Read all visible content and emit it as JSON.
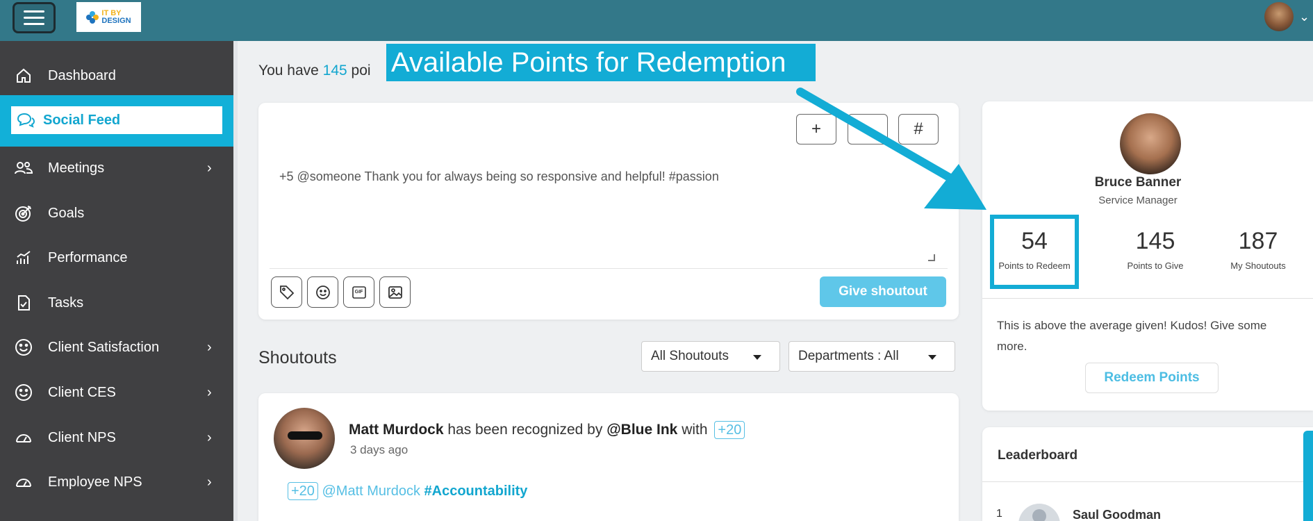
{
  "header": {
    "logo_text_top": "IT BY",
    "logo_text_bottom": "DESIGN",
    "user_menu_chevron": "⌄"
  },
  "sidebar": {
    "items": [
      {
        "label": "Dashboard",
        "icon": "home-icon",
        "has_submenu": false,
        "active": false
      },
      {
        "label": "Social Feed",
        "icon": "chat-icon",
        "has_submenu": false,
        "active": true
      },
      {
        "label": "Meetings",
        "icon": "people-icon",
        "has_submenu": true,
        "active": false
      },
      {
        "label": "Goals",
        "icon": "target-icon",
        "has_submenu": false,
        "active": false
      },
      {
        "label": "Performance",
        "icon": "performance-chart-icon",
        "has_submenu": false,
        "active": false
      },
      {
        "label": "Tasks",
        "icon": "task-document-icon",
        "has_submenu": false,
        "active": false
      },
      {
        "label": "Client Satisfaction",
        "icon": "smiley-icon",
        "has_submenu": true,
        "active": false
      },
      {
        "label": "Client CES",
        "icon": "smiley-icon",
        "has_submenu": true,
        "active": false
      },
      {
        "label": "Client NPS",
        "icon": "gauge-icon",
        "has_submenu": true,
        "active": false
      },
      {
        "label": "Employee NPS",
        "icon": "gauge-icon",
        "has_submenu": true,
        "active": false
      }
    ],
    "chevron": "›"
  },
  "points_banner": {
    "prefix": "You have",
    "points": "145",
    "suffix_visible": "poi"
  },
  "callout": {
    "text": "Available Points for Redemption",
    "color": "#13acd5"
  },
  "composer": {
    "toolbar": [
      "+",
      "•",
      "#"
    ],
    "text": "+5 @someone Thank you for always being so responsive and helpful! #passion",
    "attachments": [
      "tag-icon",
      "emoji-icon",
      "gif-icon",
      "image-icon"
    ],
    "gif_label": "GIF",
    "submit_label": "Give shoutout"
  },
  "shoutouts": {
    "title": "Shoutouts",
    "filter_all": "All Shoutouts",
    "filter_departments": "Departments : All"
  },
  "feed": {
    "items": [
      {
        "recipient": "Matt Murdock",
        "middle": "has been recognized by",
        "giver": "@Blue Ink",
        "with": "with",
        "points": "+20",
        "time": "3 days ago",
        "body_points": "+20",
        "body_mention": "@Matt Murdock",
        "body_tag": "#Accountability"
      }
    ]
  },
  "profile": {
    "name": "Bruce Banner",
    "role": "Service Manager",
    "stats": [
      {
        "value": "54",
        "label": "Points to Redeem"
      },
      {
        "value": "145",
        "label": "Points to Give"
      },
      {
        "value": "187",
        "label": "My Shoutouts"
      }
    ],
    "message": "This is above the average given! Kudos! Give some more.",
    "redeem_label": "Redeem Points"
  },
  "leaderboard": {
    "title": "Leaderboard",
    "entries": [
      {
        "rank": "1",
        "name": "Saul Goodman"
      }
    ]
  },
  "colors": {
    "topbar": "#337889",
    "sidebar": "#404042",
    "accent": "#13acd5",
    "link": "#56bfe4"
  }
}
